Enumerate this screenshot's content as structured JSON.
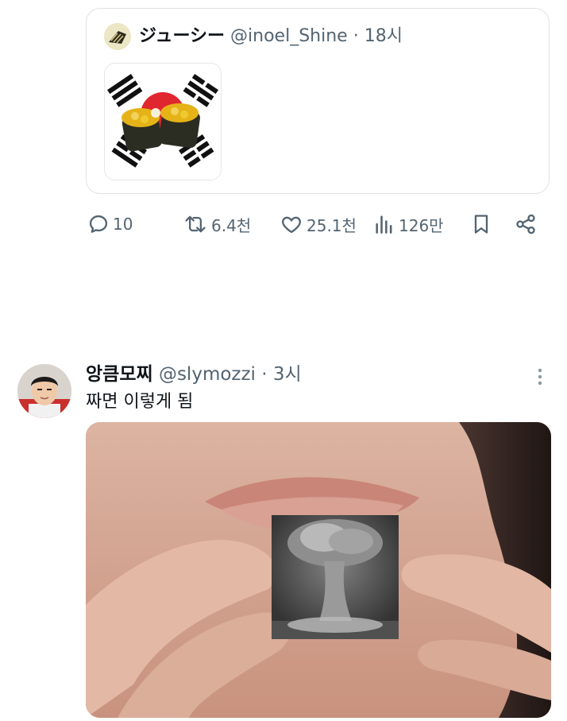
{
  "quoted": {
    "author_name": "ジューシー",
    "handle": "@inoel_Shine",
    "separator": "·",
    "time": "18시",
    "media_icon": "flag-sushi-image"
  },
  "actions": {
    "reply": {
      "icon": "reply-icon",
      "count": "10"
    },
    "repost": {
      "icon": "repost-icon",
      "count": "6.4천"
    },
    "like": {
      "icon": "heart-icon",
      "count": "25.1천"
    },
    "views": {
      "icon": "views-icon",
      "count": "126만"
    },
    "bookmark": {
      "icon": "bookmark-icon"
    },
    "share": {
      "icon": "share-icon"
    }
  },
  "post": {
    "author_name": "앙큼모찌",
    "handle": "@slymozzi",
    "separator": "·",
    "time": "3시",
    "text": "짜면 이렇게 됨",
    "more_icon": "more-vertical-icon",
    "media_icon": "lips-mushroom-cloud-image"
  },
  "colors": {
    "muted": "#536471",
    "text": "#0f1419",
    "border": "#dfe3e6"
  }
}
